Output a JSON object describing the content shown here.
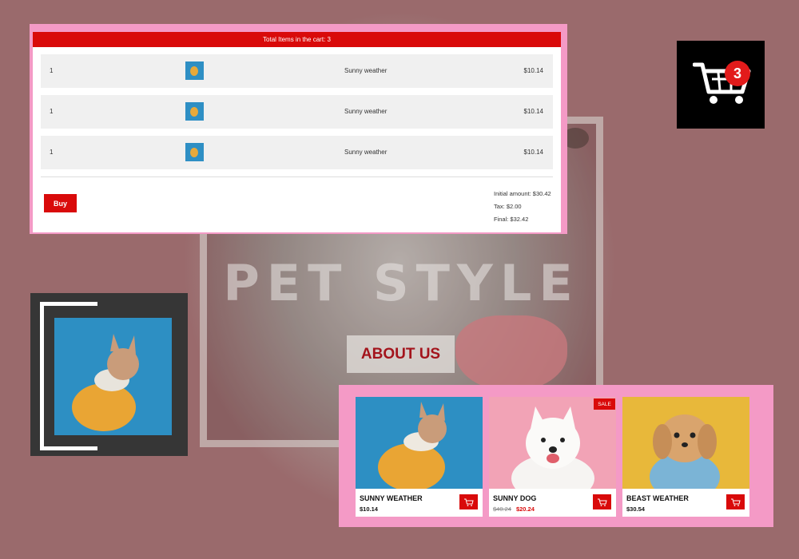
{
  "hero": {
    "title": "PET STYLE",
    "about_label": "ABOUT US"
  },
  "cart": {
    "header": "Total Items in the cart: 3",
    "items": [
      {
        "qty": "1",
        "name": "Sunny weather",
        "price": "$10.14"
      },
      {
        "qty": "1",
        "name": "Sunny weather",
        "price": "$10.14"
      },
      {
        "qty": "1",
        "name": "Sunny weather",
        "price": "$10.14"
      }
    ],
    "buy_label": "Buy",
    "initial": "Initial amount: $30.42",
    "tax": "Tax: $2.00",
    "final": "Final: $32.42"
  },
  "cart_icon": {
    "count": "3",
    "icon": "shopping-cart-icon"
  },
  "products": [
    {
      "name": "SUNNY WEATHER",
      "price": "$10.14",
      "old_price": "",
      "sale": ""
    },
    {
      "name": "SUNNY DOG",
      "price": "$20.24",
      "old_price": "$40.24",
      "sale": "SALE"
    },
    {
      "name": "BEAST WEATHER",
      "price": "$30.54",
      "old_price": "",
      "sale": ""
    }
  ],
  "colors": {
    "accent": "#d90a0a",
    "panel_pink": "#f49ac6",
    "dark_tile": "#363636"
  }
}
